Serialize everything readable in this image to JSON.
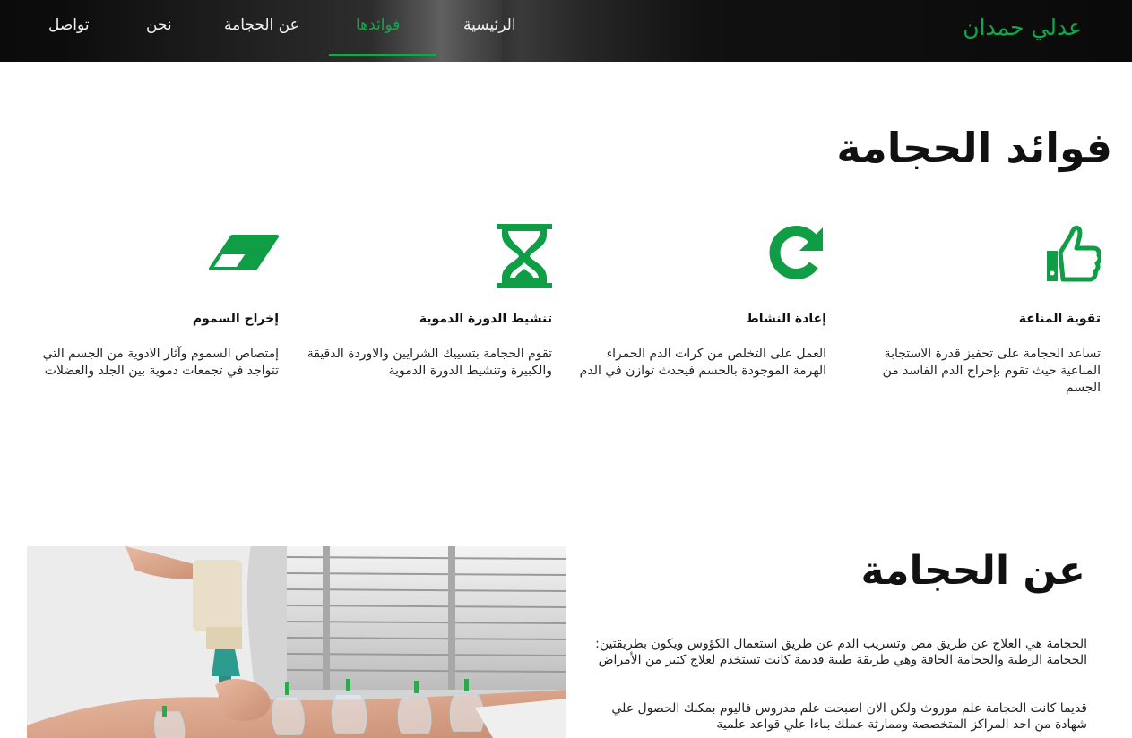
{
  "brand": {
    "name": "عدلي حمدان"
  },
  "nav": {
    "items": [
      {
        "label": "الرئيسية"
      },
      {
        "label": "فوائدها"
      },
      {
        "label": "عن الحجامة"
      },
      {
        "label": "نحن"
      },
      {
        "label": "تواصل"
      }
    ]
  },
  "benefits": {
    "title": "فوائد الحجامة",
    "items": [
      {
        "icon": "thumbs-up-icon",
        "title": "تقوية المناعة",
        "text": "تساعد الحجامة على تحفيز قدرة الاستجابة المناعية حيث تقوم بإخراج الدم الفاسد من الجسم"
      },
      {
        "icon": "refresh-icon",
        "title": "إعادة النشاط",
        "text": "العمل على التخلص من كرات الدم الحمراء الهرمة الموجودة بالجسم فيحدث توازن في الدم"
      },
      {
        "icon": "hourglass-icon",
        "title": "تنشيط الدورة الدموية",
        "text": "تقوم الحجامة بتسييك الشرايين والاوردة الدقيقة والكبيرة وتنشيط الدورة الدموية"
      },
      {
        "icon": "eraser-icon",
        "title": "إخراج السموم",
        "text": "إمتصاص السموم وآثار الادوية من الجسم التي تتواجد في تجمعات دموية بين الجلد والعضلات"
      }
    ]
  },
  "about": {
    "title": "عن الحجامة",
    "paragraphs": [
      "الحجامة هي العلاج عن طريق مص وتسريب الدم عن طريق استعمال الكؤوس ويكون بطريقتين: الحجامة الرطبة والحجامة الجافة وهي طريقة طبية قديمة كانت تستخدم لعلاج كثير من الأمراض",
      "قديما كانت الحجامة علم موروث ولكن الان اصبحت علم مدروس فاليوم بمكنك الحصول علي شهادة من احد المراكز المتخصصة وممارثة عملك بناءا علي قواعد علمية"
    ]
  },
  "colors": {
    "accent": "#15a64b",
    "nav_bg": "#0b0b0b",
    "text": "#111111"
  }
}
